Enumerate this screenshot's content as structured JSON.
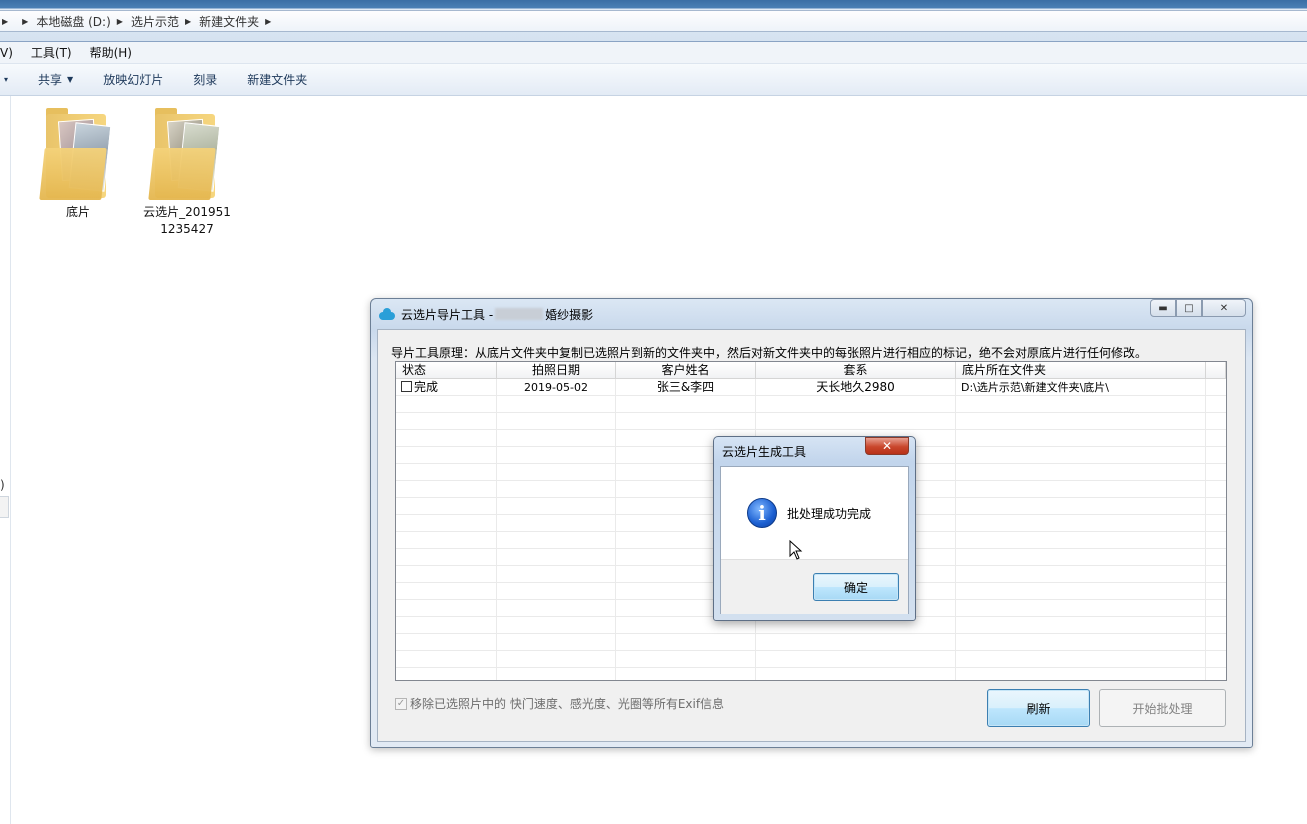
{
  "explorer": {
    "breadcrumbs": [
      "本地磁盘 (D:)",
      "选片示范",
      "新建文件夹"
    ],
    "menu": [
      "V)",
      "工具(T)",
      "帮助(H)"
    ],
    "toolbar": {
      "caret_only": "▾",
      "share": "共享",
      "slideshow": "放映幻灯片",
      "burn": "刻录",
      "new_folder": "新建文件夹"
    },
    "folders": [
      {
        "label": "底片"
      },
      {
        "label": "云选片_2019511235427"
      }
    ],
    "side_fragment": ")"
  },
  "main_window": {
    "title_prefix": "云选片导片工具 -",
    "title_suffix": "婚纱摄影",
    "principle": "导片工具原理：从底片文件夹中复制已选照片到新的文件夹中，然后对新文件夹中的每张照片进行相应的标记，绝不会对原底片进行任何修改。",
    "columns": [
      "状态",
      "拍照日期",
      "客户姓名",
      "套系",
      "底片所在文件夹"
    ],
    "rows": [
      {
        "status": "完成",
        "date": "2019-05-02",
        "customer": "张三&李四",
        "package": "天长地久2980",
        "folder": "D:\\选片示范\\新建文件夹\\底片\\"
      }
    ],
    "remove_exif_label": "移除已选照片中的 快门速度、感光度、光圈等所有Exif信息",
    "refresh_label": "刷新",
    "batch_label": "开始批处理"
  },
  "message_box": {
    "title": "云选片生成工具",
    "message": "批处理成功完成",
    "ok_label": "确定"
  }
}
